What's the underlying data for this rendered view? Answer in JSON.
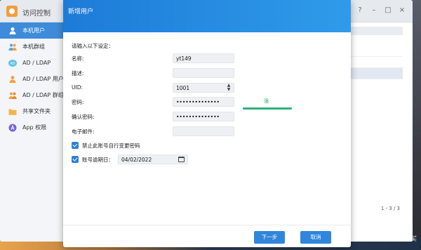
{
  "app": {
    "title": "访问控制",
    "accent_color": "#3d8bd9"
  },
  "sidebar": {
    "items": [
      {
        "label": "本机用户",
        "icon": "user-icon",
        "color": "#ffffff",
        "active": true
      },
      {
        "label": "本机群组",
        "icon": "group-icon",
        "color": "#5aa0e6",
        "active": false
      },
      {
        "label": "AD / LDAP",
        "icon": "ad-ldap-icon",
        "color": "#5cc2e8",
        "active": false
      },
      {
        "label": "AD / LDAP 用户",
        "icon": "ad-user-icon",
        "color": "#f2a240",
        "active": false
      },
      {
        "label": "AD / LDAP 群组",
        "icon": "ad-group-icon",
        "color": "#f2a240",
        "active": false
      },
      {
        "label": "共享文件夹",
        "icon": "folder-icon",
        "color": "#f2b54a",
        "active": false
      },
      {
        "label": "App 权限",
        "icon": "app-permission-icon",
        "color": "#7a63d6",
        "active": false
      }
    ]
  },
  "background_table": {
    "pager": "1 - 3 / 3"
  },
  "dialog": {
    "title": "新增用户",
    "caption": "请输入以下设定：",
    "fields": {
      "name_label": "名称:",
      "name_value": "yt149",
      "desc_label": "描述:",
      "desc_value": "",
      "uid_label": "UID:",
      "uid_value": "1001",
      "password_label": "密码:",
      "password_value": "••••••••••••••",
      "confirm_label": "确认密码:",
      "confirm_value": "••••••••••••••",
      "email_label": "电子邮件:",
      "email_value": ""
    },
    "password_strength": {
      "label": "强",
      "level": 1.0,
      "color": "#2eb17a"
    },
    "checkbox_disable_change": {
      "label": "禁止此账号自行变更密码",
      "checked": true
    },
    "checkbox_expiry": {
      "label": "账号逾期日：",
      "checked": true,
      "date_value": "04/02/2022"
    },
    "buttons": {
      "next": "下一步",
      "cancel": "取消"
    }
  },
  "watermark": "值 什么值得买"
}
